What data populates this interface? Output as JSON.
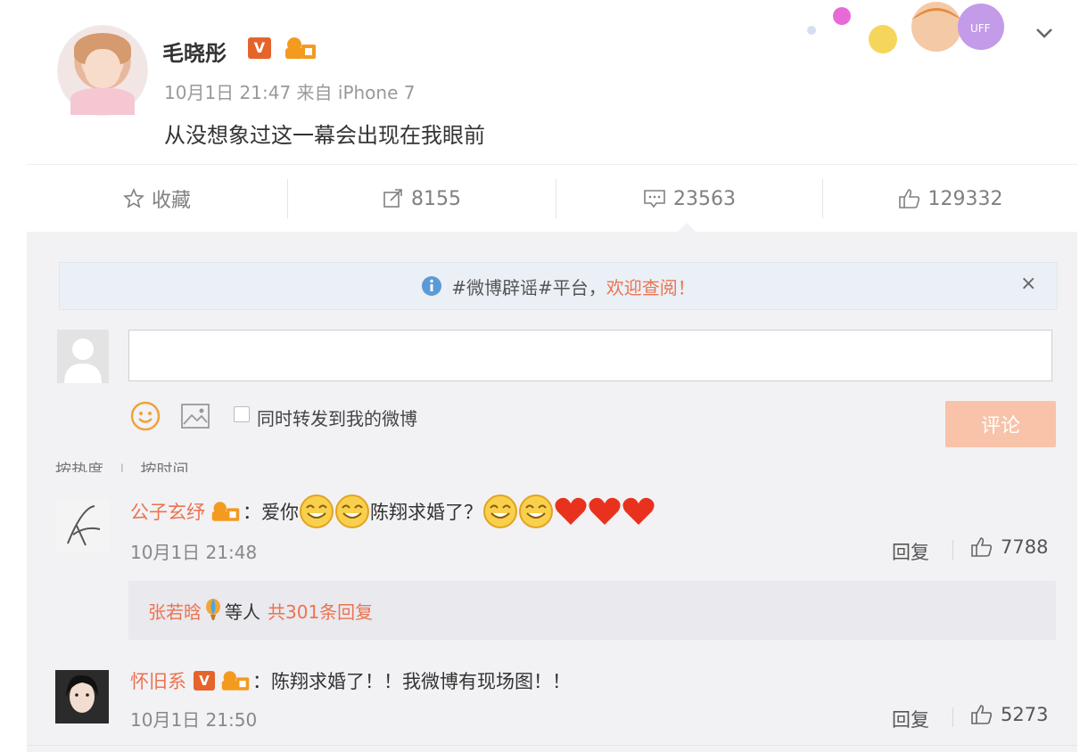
{
  "post": {
    "username": "毛晓彤",
    "v_badge": "V",
    "meta": "10月1日 21:47 来自 iPhone 7",
    "text": "从没想象过这一幕会出现在我眼前"
  },
  "actions": {
    "favorite": "收藏",
    "repost_count": "8155",
    "comment_count": "23563",
    "like_count": "129332"
  },
  "notice": {
    "prefix": "#微博辟谣#平台，",
    "link": "欢迎查阅",
    "suffix": "！",
    "close": "×"
  },
  "composer": {
    "input_value": "",
    "forward_label": "同时转发到我的微博",
    "submit_label": "评论"
  },
  "sort": {
    "by_hot": "按热度",
    "by_time": "按时间"
  },
  "comments": [
    {
      "name": "公子玄纾",
      "text_a": "：爱你",
      "text_b": "陈翔求婚了？",
      "time": "10月1日 21:48",
      "reply_label": "回复",
      "likes": "7788"
    },
    {
      "name": "怀旧系",
      "v_badge": "V",
      "text_a": "：陈翔求婚了！！我微博有现场图！！",
      "time": "10月1日 21:50",
      "reply_label": "回复",
      "likes": "5273"
    }
  ],
  "subreply": {
    "name": "张若晗",
    "middle": "等人",
    "count_text": "共301条回复"
  },
  "colors": {
    "accent": "#eb7350",
    "v_badge": "#e5642b",
    "submit_disabled": "#f8c3a9"
  }
}
